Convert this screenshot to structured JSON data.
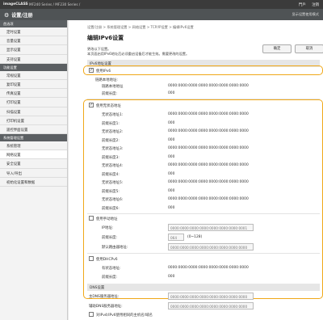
{
  "header": {
    "brand": "imageCLASS",
    "model": "MF240 Series / MF230 Series /",
    "links": [
      "門戶",
      "注销"
    ],
    "title": "设置/注册",
    "right_link": "显示设置使用模式"
  },
  "sidebar": {
    "sections": [
      {
        "label": "首选项",
        "items": [
          "定时设置",
          "音量设置",
          "显示设置",
          "支持设置"
        ]
      },
      {
        "label": "功能设置",
        "items": [
          "常规设置",
          "复印设置",
          "传真设置",
          "打印设置",
          "扫描设置",
          "打印机设置",
          "遥控界面设置"
        ]
      },
      {
        "label": "系统管理设置",
        "items": [
          "系统管理",
          "网络设置",
          "安全设置",
          "导入/导出",
          "初始化设置和数据"
        ]
      }
    ],
    "active_item": "网络设置"
  },
  "main": {
    "breadcrumb": "设置/注册 > 系统管理设置 > 网络设置 > TCP/IP设置 > 编辑IPv6设置",
    "title": "编辑IPv6设置",
    "hint1": "更改以下设置。",
    "hint2": "本页面启用IPv6地址后必须重启设备后才能生效。需要更改的设置。",
    "ok_label": "确定",
    "cancel_label": "取消",
    "ipv6_section": "IPv6地址设置",
    "use_ipv6": "使用IPv6",
    "link_local_label": "链路本地地址:",
    "link_local_addr_label": "链路本地地址",
    "link_local_addr_value": "0000:0000:0000:0000:0000:0000:0000:0000",
    "prefix_len_label": "前缀长度:",
    "prefix_len_value": "000",
    "stateless_label": "使用无状态地址",
    "stateless_rows": [
      {
        "addr_label": "无状态地址1:",
        "addr": "0000:0000:0000:0000:0000:0000:0000:0000",
        "len_label": "前缀长度1:",
        "len": "000"
      },
      {
        "addr_label": "无状态地址2:",
        "addr": "0000:0000:0000:0000:0000:0000:0000:0000",
        "len_label": "前缀长度2:",
        "len": "000"
      },
      {
        "addr_label": "无状态地址3:",
        "addr": "0000:0000:0000:0000:0000:0000:0000:0000",
        "len_label": "前缀长度3:",
        "len": "000"
      },
      {
        "addr_label": "无状态地址4:",
        "addr": "0000:0000:0000:0000:0000:0000:0000:0000",
        "len_label": "前缀长度4:",
        "len": "000"
      },
      {
        "addr_label": "无状态地址5:",
        "addr": "0000:0000:0000:0000:0000:0000:0000:0000",
        "len_label": "前缀长度5:",
        "len": "000"
      },
      {
        "addr_label": "无状态地址6:",
        "addr": "0000:0000:0000:0000:0000:0000:0000:0000",
        "len_label": "前缀长度6:",
        "len": "000"
      }
    ],
    "manual_label": "使用手动地址",
    "manual_addr_label": "IP地址:",
    "manual_addr_value": "0000:0000:0000:0000:0000:0000:0000:0001",
    "manual_len_label": "前缀长度:",
    "manual_len_value": "064",
    "manual_len_range": "(0~128)",
    "default_router_label": "默认路由器地址:",
    "default_router_value": "0000:0000:0000:0000:0000:0000:0000:0000",
    "dhcp_label": "使用DHCPv6",
    "dhcp_addr_label": "有状态地址:",
    "dhcp_addr_value": "0000:0000:0000:0000:0000:0000:0000:0000",
    "dhcp_len_label": "前缀长度:",
    "dhcp_len_value": "000",
    "dns_section": "DNS设置",
    "primary_dns_label": "主DNS服务器地址:",
    "primary_dns_value": "0000:0000:0000:0000:0000:0000:0000:0000",
    "secondary_dns_label": "辅助DNS服务器地址:",
    "secondary_dns_value": "0000:0000:0000:0000:0000:0000:0000:0000",
    "dns_extra_label": "对IPv4/IPv6使用相同的主机名/域名"
  },
  "colors": {
    "highlight": "#f0a818",
    "header": "#3b3b3b",
    "titlebar": "#4f5355"
  }
}
